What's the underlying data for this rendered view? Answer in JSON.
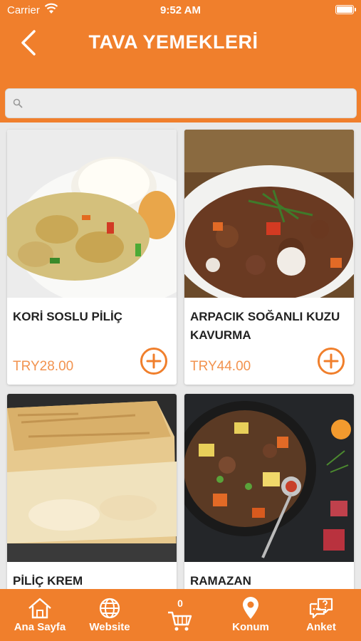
{
  "status": {
    "carrier": "Carrier",
    "time": "9:52 AM"
  },
  "header": {
    "title": "TAVA YEMEKLERİ"
  },
  "search": {
    "placeholder": ""
  },
  "products": [
    {
      "name": "KORİ SOSLU PİLİÇ",
      "price": "TRY28.00"
    },
    {
      "name": "ARPACIK SOĞANLI KUZU KAVURMA",
      "price": "TRY44.00"
    },
    {
      "name": "PİLİÇ KREM",
      "price": ""
    },
    {
      "name": "RAMAZAN",
      "price": ""
    }
  ],
  "tabbar": {
    "home": "Ana Sayfa",
    "website": "Website",
    "cart_count": "0",
    "location": "Konum",
    "survey": "Anket"
  },
  "colors": {
    "accent": "#f07f2c",
    "price": "#f2934f"
  }
}
